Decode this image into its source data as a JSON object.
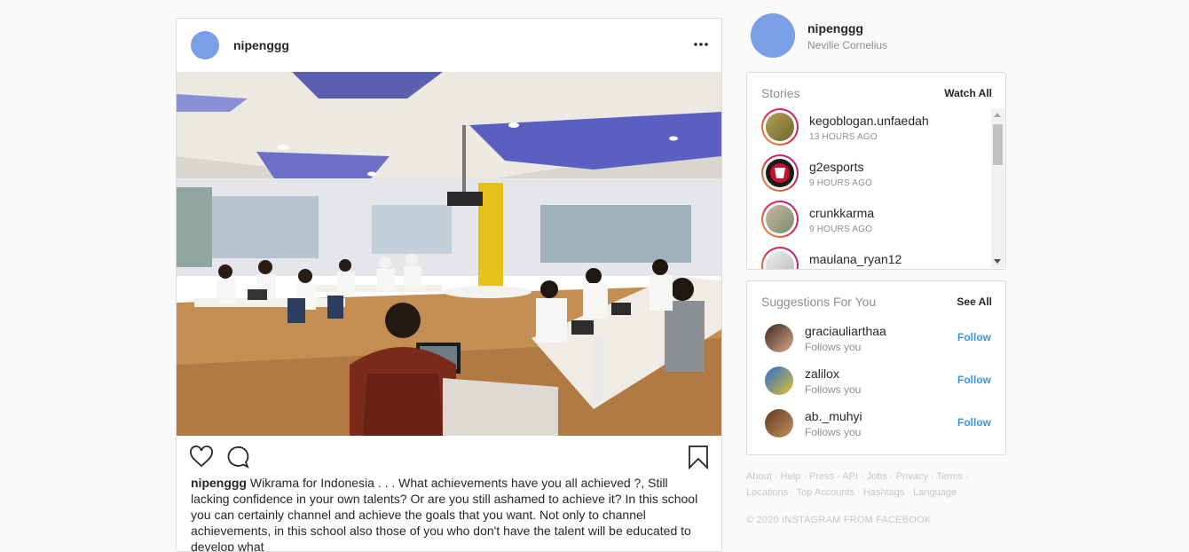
{
  "post": {
    "username": "nipenggg",
    "caption_user": "nipenggg",
    "caption_text": "Wikrama for Indonesia . . . What achievements have you all achieved ?, Still lacking confidence in your own talents? Or are you still ashamed to achieve it? In this school you can certainly channel and achieve the goals that you want. Not only to channel achievements, in this school also those of you who don't have the talent will be educated to develop what"
  },
  "profile": {
    "username": "nipenggg",
    "full_name": "Neville Cornelius"
  },
  "stories": {
    "title": "Stories",
    "link": "Watch All",
    "items": [
      {
        "name": "kegoblogan.unfaedah",
        "time": "13 HOURS AGO"
      },
      {
        "name": "g2esports",
        "time": "9 HOURS AGO"
      },
      {
        "name": "crunkkarma",
        "time": "9 HOURS AGO"
      },
      {
        "name": "maulana_ryan12",
        "time": ""
      }
    ]
  },
  "suggestions": {
    "title": "Suggestions For You",
    "link": "See All",
    "items": [
      {
        "name": "graciauliarthaa",
        "sub": "Follows you",
        "action": "Follow"
      },
      {
        "name": "zalilox",
        "sub": "Follows you",
        "action": "Follow"
      },
      {
        "name": "ab._muhyi",
        "sub": "Follows you",
        "action": "Follow"
      }
    ]
  },
  "footer": {
    "links": [
      "About",
      "Help",
      "Press",
      "API",
      "Jobs",
      "Privacy",
      "Terms",
      "Locations",
      "Top Accounts",
      "Hashtags",
      "Language"
    ],
    "copyright": "© 2020 INSTAGRAM FROM FACEBOOK"
  },
  "colors": {
    "link_blue": "#3897f0",
    "avatar_blue": "#7a9fe6",
    "muted": "#8e8e8e"
  },
  "icons": [
    "more-icon",
    "heart-icon",
    "comment-icon",
    "bookmark-icon"
  ]
}
